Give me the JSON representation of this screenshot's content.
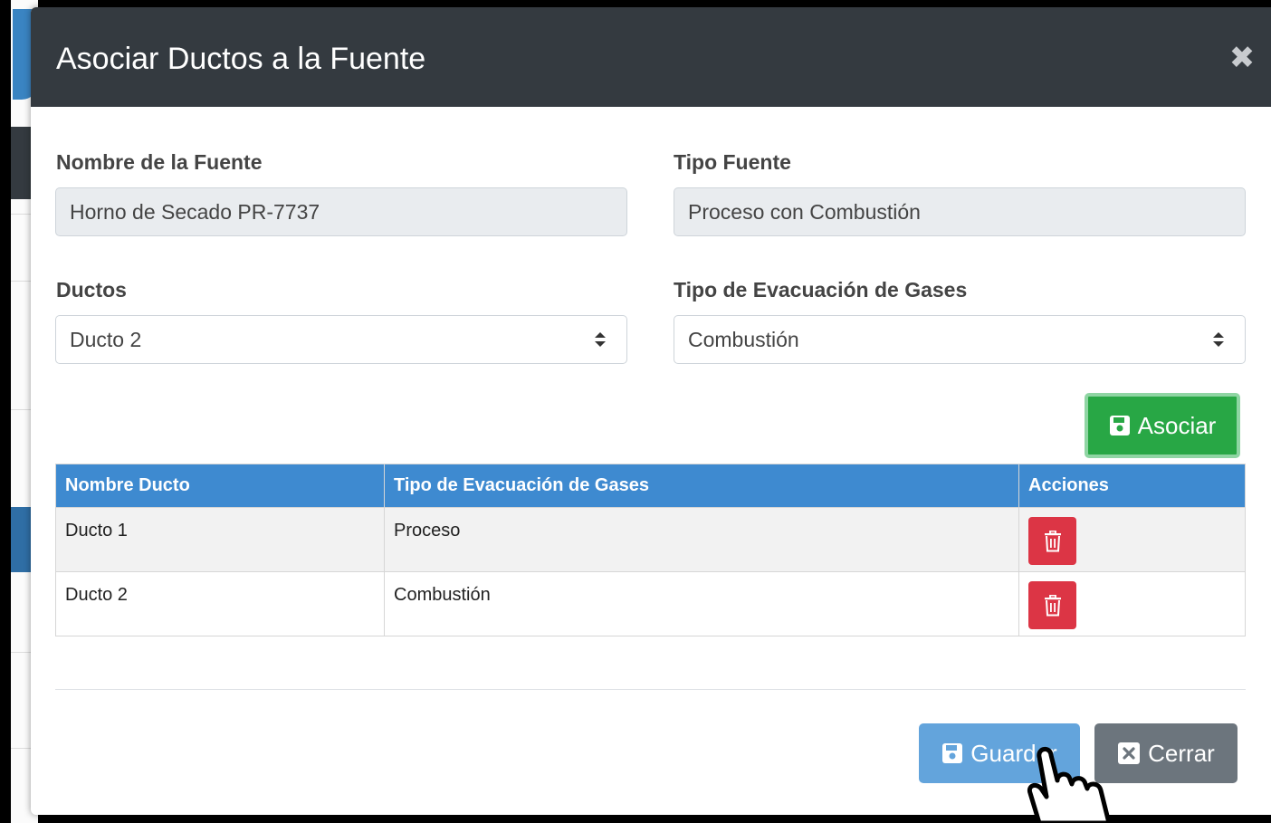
{
  "modal": {
    "title": "Asociar Ductos a la Fuente",
    "close_symbol": "✖"
  },
  "form": {
    "fuente_label": "Nombre de la Fuente",
    "fuente_value": "Horno de Secado PR-7737",
    "tipo_fuente_label": "Tipo Fuente",
    "tipo_fuente_value": "Proceso con Combustión",
    "ductos_label": "Ductos",
    "ductos_selected": "Ducto 2",
    "evacuacion_label": "Tipo de Evacuación de Gases",
    "evacuacion_selected": "Combustión"
  },
  "buttons": {
    "asociar": "Asociar",
    "guardar": "Guardar",
    "cerrar": "Cerrar"
  },
  "table": {
    "headers": [
      "Nombre Ducto",
      "Tipo de Evacuación de Gases",
      "Acciones"
    ],
    "rows": [
      {
        "ducto": "Ducto 1",
        "tipo": "Proceso"
      },
      {
        "ducto": "Ducto 2",
        "tipo": "Combustión"
      }
    ]
  },
  "colors": {
    "header_bg": "#343a40",
    "table_header": "#3e8ad0",
    "success": "#28a745",
    "danger": "#dc3545",
    "primary_light": "#63a4dc",
    "secondary": "#6c757d"
  },
  "icons": {
    "close": "close-icon",
    "save": "save-icon",
    "trash": "trash-icon",
    "window_close": "window-close-icon",
    "pointer": "hand-pointer-icon"
  }
}
